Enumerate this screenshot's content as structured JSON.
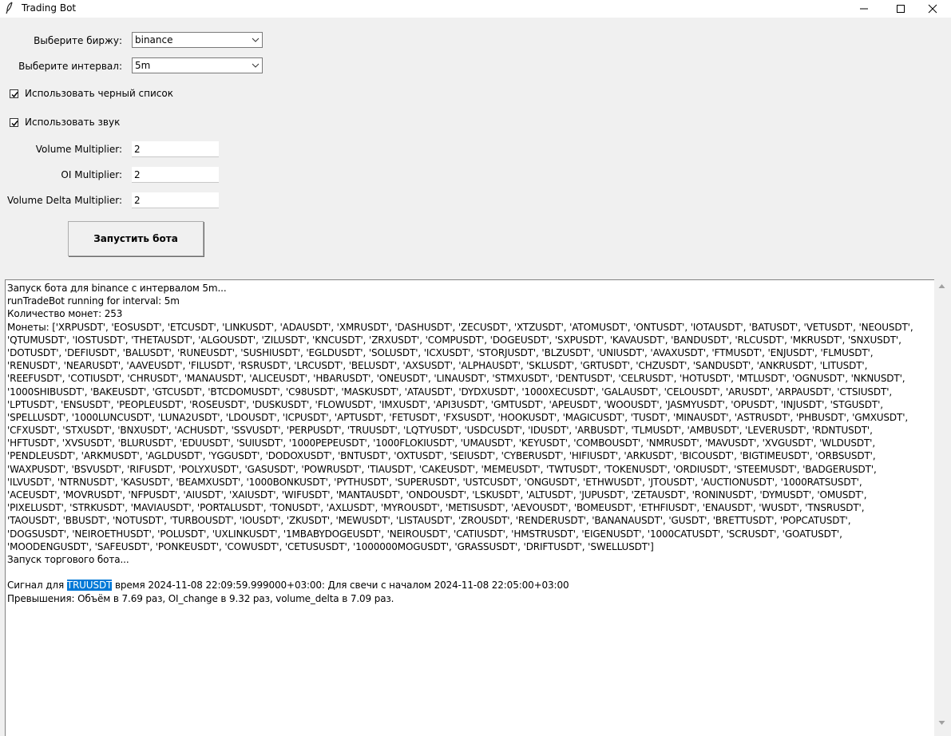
{
  "window": {
    "title": "Trading Bot",
    "icon": "feather-icon",
    "controls": [
      "minimize-icon",
      "maximize-icon",
      "close-icon"
    ]
  },
  "form": {
    "exchange_label": "Выберите биржу:",
    "exchange_value": "binance",
    "interval_label": "Выберите интервал:",
    "interval_value": "5m",
    "blacklist_label": "Использовать черный список",
    "blacklist_checked": true,
    "sound_label": "Использовать звук",
    "sound_checked": true,
    "volume_multiplier_label": "Volume Multiplier:",
    "volume_multiplier_value": "2",
    "oi_multiplier_label": "OI Multiplier:",
    "oi_multiplier_value": "2",
    "volume_delta_multiplier_label": "Volume Delta Multiplier:",
    "volume_delta_multiplier_value": "2",
    "start_button_label": "Запустить бота"
  },
  "log": {
    "lines": [
      "Запуск бота для binance с интервалом 5m...",
      "runTradeBot running for interval: 5m",
      "Количество монет: 253",
      "Монеты: ['XRPUSDT', 'EOSUSDT', 'ETCUSDT', 'LINKUSDT', 'ADAUSDT', 'XMRUSDT', 'DASHUSDT', 'ZECUSDT', 'XTZUSDT', 'ATOMUSDT', 'ONTUSDT', 'IOTAUSDT', 'BATUSDT', 'VETUSDT', 'NEOUSDT',",
      "'QTUMUSDT', 'IOSTUSDT', 'THETAUSDT', 'ALGOUSDT', 'ZILUSDT', 'KNCUSDT', 'ZRXUSDT', 'COMPUSDT', 'DOGEUSDT', 'SXPUSDT', 'KAVAUSDT', 'BANDUSDT', 'RLCUSDT', 'MKRUSDT', 'SNXUSDT',",
      "'DOTUSDT', 'DEFIUSDT', 'BALUSDT', 'RUNEUSDT', 'SUSHIUSDT', 'EGLDUSDT', 'SOLUSDT', 'ICXUSDT', 'STORJUSDT', 'BLZUSDT', 'UNIUSDT', 'AVAXUSDT', 'FTMUSDT', 'ENJUSDT', 'FLMUSDT',",
      "'RENUSDT', 'NEARUSDT', 'AAVEUSDT', 'FILUSDT', 'RSRUSDT', 'LRCUSDT', 'BELUSDT', 'AXSUSDT', 'ALPHAUSDT', 'SKLUSDT', 'GRTUSDT', 'CHZUSDT', 'SANDUSDT', 'ANKRUSDT', 'LITUSDT',",
      "'REEFUSDT', 'COTIUSDT', 'CHRUSDT', 'MANAUSDT', 'ALICEUSDT', 'HBARUSDT', 'ONEUSDT', 'LINAUSDT', 'STMXUSDT', 'DENTUSDT', 'CELRUSDT', 'HOTUSDT', 'MTLUSDT', 'OGNUSDT', 'NKNUSDT',",
      "'1000SHIBUSDT', 'BAKEUSDT', 'GTCUSDT', 'BTCDOMUSDT', 'C98USDT', 'MASKUSDT', 'ATAUSDT', 'DYDXUSDT', '1000XECUSDT', 'GALAUSDT', 'CELOUSDT', 'ARUSDT', 'ARPAUSDT', 'CTSIUSDT',",
      "'LPTUSDT', 'ENSUSDT', 'PEOPLEUSDT', 'ROSEUSDT', 'DUSKUSDT', 'FLOWUSDT', 'IMXUSDT', 'API3USDT', 'GMTUSDT', 'APEUSDT', 'WOOUSDT', 'JASMYUSDT', 'OPUSDT', 'INJUSDT', 'STGUSDT',",
      "'SPELLUSDT', '1000LUNCUSDT', 'LUNA2USDT', 'LDOUSDT', 'ICPUSDT', 'APTUSDT', 'FETUSDT', 'FXSUSDT', 'HOOKUSDT', 'MAGICUSDT', 'TUSDT', 'MINAUSDT', 'ASTRUSDT', 'PHBUSDT', 'GMXUSDT',",
      "'CFXUSDT', 'STXUSDT', 'BNXUSDT', 'ACHUSDT', 'SSVUSDT', 'PERPUSDT', 'TRUUSDT', 'LQTYUSDT', 'USDCUSDT', 'IDUSDT', 'ARBUSDT', 'TLMUSDT', 'AMBUSDT', 'LEVERUSDT', 'RDNTUSDT',",
      "'HFTUSDT', 'XVSUSDT', 'BLURUSDT', 'EDUUSDT', 'SUIUSDT', '1000PEPEUSDT', '1000FLOKIUSDT', 'UMAUSDT', 'KEYUSDT', 'COMBOUSDT', 'NMRUSDT', 'MAVUSDT', 'XVGUSDT', 'WLDUSDT',",
      "'PENDLEUSDT', 'ARKMUSDT', 'AGLDUSDT', 'YGGUSDT', 'DODOXUSDT', 'BNTUSDT', 'OXTUSDT', 'SEIUSDT', 'CYBERUSDT', 'HIFIUSDT', 'ARKUSDT', 'BICOUSDT', 'BIGTIMEUSDT', 'ORBSUSDT',",
      "'WAXPUSDT', 'BSVUSDT', 'RIFUSDT', 'POLYXUSDT', 'GASUSDT', 'POWRUSDT', 'TIAUSDT', 'CAKEUSDT', 'MEMEUSDT', 'TWTUSDT', 'TOKENUSDT', 'ORDIUSDT', 'STEEMUSDT', 'BADGERUSDT',",
      "'ILVUSDT', 'NTRNUSDT', 'KASUSDT', 'BEAMXUSDT', '1000BONKUSDT', 'PYTHUSDT', 'SUPERUSDT', 'USTCUSDT', 'ONGUSDT', 'ETHWUSDT', 'JTOUSDT', 'AUCTIONUSDT', '1000RATSUSDT',",
      "'ACEUSDT', 'MOVRUSDT', 'NFPUSDT', 'AIUSDT', 'XAIUSDT', 'WIFUSDT', 'MANTAUSDT', 'ONDOUSDT', 'LSKUSDT', 'ALTUSDT', 'JUPUSDT', 'ZETAUSDT', 'RONINUSDT', 'DYMUSDT', 'OMUSDT',",
      "'PIXELUSDT', 'STRKUSDT', 'MAVIAUSDT', 'PORTALUSDT', 'TONUSDT', 'AXLUSDT', 'MYROUSDT', 'METISUSDT', 'AEVOUSDT', 'BOMEUSDT', 'ETHFIUSDT', 'ENAUSDT', 'WUSDT', 'TNSRUSDT',",
      "'TAOUSDT', 'BBUSDT', 'NOTUSDT', 'TURBOUSDT', 'IOUSDT', 'ZKUSDT', 'MEWUSDT', 'LISTAUSDT', 'ZROUSDT', 'RENDERUSDT', 'BANANAUSDT', 'GUSDT', 'BRETTUSDT', 'POPCATUSDT',",
      "'DOGSUSDT', 'NEIROETHUSDT', 'POLUSDT', 'UXLINKUSDT', '1MBABYDOGEUSDT', 'NEIROUSDT', 'CATIUSDT', 'HMSTRUSDT', 'EIGENUSDT', '1000CATUSDT', 'SCRUSDT', 'GOATUSDT',",
      "'MOODENGUSDT', 'SAFEUSDT', 'PONKEUSDT', 'COWUSDT', 'CETUSUSDT', '1000000MOGUSDT', 'GRASSUSDT', 'DRIFTUSDT', 'SWELLUSDT']",
      "Запуск торгового бота..."
    ],
    "signal_prefix": "Сигнал для ",
    "signal_symbol": "TRUUSDT",
    "signal_rest": " время 2024-11-08 22:09:59.999000+03:00: Для свечи с началом 2024-11-08 22:05:00+03:00",
    "excess_line": "Превышения: Объём в 7.69 раз, OI_change в 9.32 раз, volume_delta в 7.09 раз."
  },
  "colors": {
    "selection": "#0078d7",
    "window_bg": "#f0f0f0"
  }
}
